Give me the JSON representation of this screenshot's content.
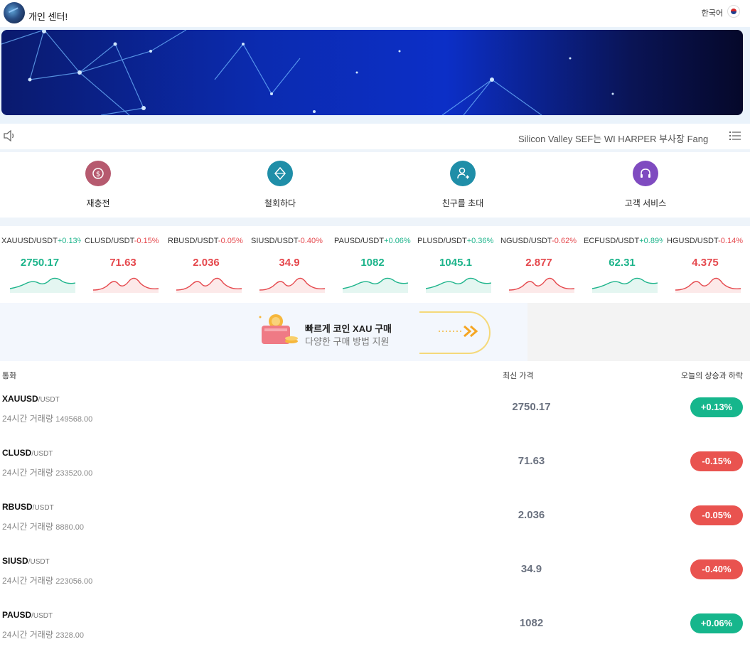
{
  "header": {
    "title": "개인 센터!",
    "language": "한국어"
  },
  "notice": {
    "text": "Silicon Valley SEF는 WI HARPER 부사장 Fang"
  },
  "actions": [
    {
      "label": "재충전",
      "icon": "recharge-icon",
      "color": "#b65a6f"
    },
    {
      "label": "철회하다",
      "icon": "withdraw-icon",
      "color": "#1f8ea8"
    },
    {
      "label": "친구를 초대",
      "icon": "invite-friend-icon",
      "color": "#1f8ea8"
    },
    {
      "label": "고객 서비스",
      "icon": "headset-icon",
      "color": "#7f4bc0"
    }
  ],
  "tickers": [
    {
      "symbol": "XAUUSD/USDT",
      "change": "+0.13%",
      "price": "2750.17",
      "trend": "up"
    },
    {
      "symbol": "CLUSD/USDT",
      "change": "-0.15%",
      "price": "71.63",
      "trend": "down"
    },
    {
      "symbol": "RBUSD/USDT",
      "change": "-0.05%",
      "price": "2.036",
      "trend": "down"
    },
    {
      "symbol": "SIUSD/USDT",
      "change": "-0.40%",
      "price": "34.9",
      "trend": "down"
    },
    {
      "symbol": "PAUSD/USDT",
      "change": "+0.06%",
      "price": "1082",
      "trend": "up"
    },
    {
      "symbol": "PLUSD/USDT",
      "change": "+0.36%",
      "price": "1045.1",
      "trend": "up"
    },
    {
      "symbol": "NGUSD/USDT",
      "change": "-0.62%",
      "price": "2.877",
      "trend": "down"
    },
    {
      "symbol": "ECFUSD/USDT",
      "change": "+0.89%",
      "price": "62.31",
      "trend": "up"
    },
    {
      "symbol": "HGUSD/USDT",
      "change": "-0.14%",
      "price": "4.375",
      "trend": "down"
    }
  ],
  "promo": {
    "title": "빠르게 코인 XAU 구매",
    "subtitle": "다양한 구매 방법 지원"
  },
  "table": {
    "col_currency": "통화",
    "col_price": "최신 가격",
    "col_change": "오늘의 상승과 하락",
    "volume_label": "24시간 거래량",
    "rows": [
      {
        "base": "XAUUSD",
        "quote": "/USDT",
        "volume": "149568.00",
        "price": "2750.17",
        "change": "+0.13%",
        "trend": "up"
      },
      {
        "base": "CLUSD",
        "quote": "/USDT",
        "volume": "233520.00",
        "price": "71.63",
        "change": "-0.15%",
        "trend": "down"
      },
      {
        "base": "RBUSD",
        "quote": "/USDT",
        "volume": "8880.00",
        "price": "2.036",
        "change": "-0.05%",
        "trend": "down"
      },
      {
        "base": "SIUSD",
        "quote": "/USDT",
        "volume": "223056.00",
        "price": "34.9",
        "change": "-0.40%",
        "trend": "down"
      },
      {
        "base": "PAUSD",
        "quote": "/USDT",
        "volume": "2328.00",
        "price": "1082",
        "change": "+0.06%",
        "trend": "up"
      }
    ]
  }
}
